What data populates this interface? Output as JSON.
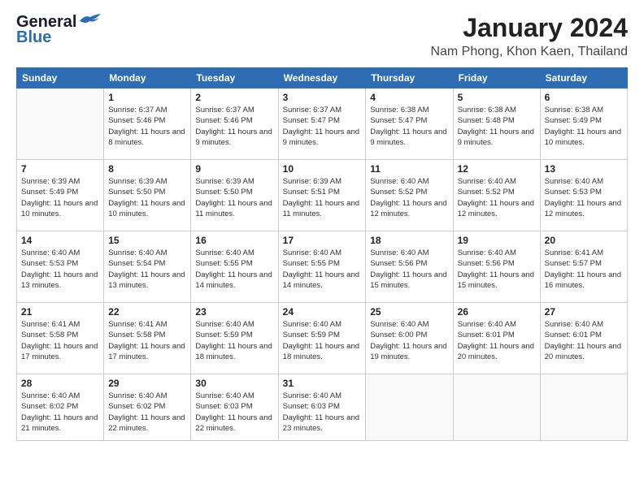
{
  "logo": {
    "general": "General",
    "blue": "Blue"
  },
  "header": {
    "month_year": "January 2024",
    "location": "Nam Phong, Khon Kaen, Thailand"
  },
  "weekdays": [
    "Sunday",
    "Monday",
    "Tuesday",
    "Wednesday",
    "Thursday",
    "Friday",
    "Saturday"
  ],
  "weeks": [
    [
      {
        "day": "",
        "sunrise": "",
        "sunset": "",
        "daylight": ""
      },
      {
        "day": "1",
        "sunrise": "Sunrise: 6:37 AM",
        "sunset": "Sunset: 5:46 PM",
        "daylight": "Daylight: 11 hours and 8 minutes."
      },
      {
        "day": "2",
        "sunrise": "Sunrise: 6:37 AM",
        "sunset": "Sunset: 5:46 PM",
        "daylight": "Daylight: 11 hours and 9 minutes."
      },
      {
        "day": "3",
        "sunrise": "Sunrise: 6:37 AM",
        "sunset": "Sunset: 5:47 PM",
        "daylight": "Daylight: 11 hours and 9 minutes."
      },
      {
        "day": "4",
        "sunrise": "Sunrise: 6:38 AM",
        "sunset": "Sunset: 5:47 PM",
        "daylight": "Daylight: 11 hours and 9 minutes."
      },
      {
        "day": "5",
        "sunrise": "Sunrise: 6:38 AM",
        "sunset": "Sunset: 5:48 PM",
        "daylight": "Daylight: 11 hours and 9 minutes."
      },
      {
        "day": "6",
        "sunrise": "Sunrise: 6:38 AM",
        "sunset": "Sunset: 5:49 PM",
        "daylight": "Daylight: 11 hours and 10 minutes."
      }
    ],
    [
      {
        "day": "7",
        "sunrise": "Sunrise: 6:39 AM",
        "sunset": "Sunset: 5:49 PM",
        "daylight": "Daylight: 11 hours and 10 minutes."
      },
      {
        "day": "8",
        "sunrise": "Sunrise: 6:39 AM",
        "sunset": "Sunset: 5:50 PM",
        "daylight": "Daylight: 11 hours and 10 minutes."
      },
      {
        "day": "9",
        "sunrise": "Sunrise: 6:39 AM",
        "sunset": "Sunset: 5:50 PM",
        "daylight": "Daylight: 11 hours and 11 minutes."
      },
      {
        "day": "10",
        "sunrise": "Sunrise: 6:39 AM",
        "sunset": "Sunset: 5:51 PM",
        "daylight": "Daylight: 11 hours and 11 minutes."
      },
      {
        "day": "11",
        "sunrise": "Sunrise: 6:40 AM",
        "sunset": "Sunset: 5:52 PM",
        "daylight": "Daylight: 11 hours and 12 minutes."
      },
      {
        "day": "12",
        "sunrise": "Sunrise: 6:40 AM",
        "sunset": "Sunset: 5:52 PM",
        "daylight": "Daylight: 11 hours and 12 minutes."
      },
      {
        "day": "13",
        "sunrise": "Sunrise: 6:40 AM",
        "sunset": "Sunset: 5:53 PM",
        "daylight": "Daylight: 11 hours and 12 minutes."
      }
    ],
    [
      {
        "day": "14",
        "sunrise": "Sunrise: 6:40 AM",
        "sunset": "Sunset: 5:53 PM",
        "daylight": "Daylight: 11 hours and 13 minutes."
      },
      {
        "day": "15",
        "sunrise": "Sunrise: 6:40 AM",
        "sunset": "Sunset: 5:54 PM",
        "daylight": "Daylight: 11 hours and 13 minutes."
      },
      {
        "day": "16",
        "sunrise": "Sunrise: 6:40 AM",
        "sunset": "Sunset: 5:55 PM",
        "daylight": "Daylight: 11 hours and 14 minutes."
      },
      {
        "day": "17",
        "sunrise": "Sunrise: 6:40 AM",
        "sunset": "Sunset: 5:55 PM",
        "daylight": "Daylight: 11 hours and 14 minutes."
      },
      {
        "day": "18",
        "sunrise": "Sunrise: 6:40 AM",
        "sunset": "Sunset: 5:56 PM",
        "daylight": "Daylight: 11 hours and 15 minutes."
      },
      {
        "day": "19",
        "sunrise": "Sunrise: 6:40 AM",
        "sunset": "Sunset: 5:56 PM",
        "daylight": "Daylight: 11 hours and 15 minutes."
      },
      {
        "day": "20",
        "sunrise": "Sunrise: 6:41 AM",
        "sunset": "Sunset: 5:57 PM",
        "daylight": "Daylight: 11 hours and 16 minutes."
      }
    ],
    [
      {
        "day": "21",
        "sunrise": "Sunrise: 6:41 AM",
        "sunset": "Sunset: 5:58 PM",
        "daylight": "Daylight: 11 hours and 17 minutes."
      },
      {
        "day": "22",
        "sunrise": "Sunrise: 6:41 AM",
        "sunset": "Sunset: 5:58 PM",
        "daylight": "Daylight: 11 hours and 17 minutes."
      },
      {
        "day": "23",
        "sunrise": "Sunrise: 6:40 AM",
        "sunset": "Sunset: 5:59 PM",
        "daylight": "Daylight: 11 hours and 18 minutes."
      },
      {
        "day": "24",
        "sunrise": "Sunrise: 6:40 AM",
        "sunset": "Sunset: 5:59 PM",
        "daylight": "Daylight: 11 hours and 18 minutes."
      },
      {
        "day": "25",
        "sunrise": "Sunrise: 6:40 AM",
        "sunset": "Sunset: 6:00 PM",
        "daylight": "Daylight: 11 hours and 19 minutes."
      },
      {
        "day": "26",
        "sunrise": "Sunrise: 6:40 AM",
        "sunset": "Sunset: 6:01 PM",
        "daylight": "Daylight: 11 hours and 20 minutes."
      },
      {
        "day": "27",
        "sunrise": "Sunrise: 6:40 AM",
        "sunset": "Sunset: 6:01 PM",
        "daylight": "Daylight: 11 hours and 20 minutes."
      }
    ],
    [
      {
        "day": "28",
        "sunrise": "Sunrise: 6:40 AM",
        "sunset": "Sunset: 6:02 PM",
        "daylight": "Daylight: 11 hours and 21 minutes."
      },
      {
        "day": "29",
        "sunrise": "Sunrise: 6:40 AM",
        "sunset": "Sunset: 6:02 PM",
        "daylight": "Daylight: 11 hours and 22 minutes."
      },
      {
        "day": "30",
        "sunrise": "Sunrise: 6:40 AM",
        "sunset": "Sunset: 6:03 PM",
        "daylight": "Daylight: 11 hours and 22 minutes."
      },
      {
        "day": "31",
        "sunrise": "Sunrise: 6:40 AM",
        "sunset": "Sunset: 6:03 PM",
        "daylight": "Daylight: 11 hours and 23 minutes."
      },
      {
        "day": "",
        "sunrise": "",
        "sunset": "",
        "daylight": ""
      },
      {
        "day": "",
        "sunrise": "",
        "sunset": "",
        "daylight": ""
      },
      {
        "day": "",
        "sunrise": "",
        "sunset": "",
        "daylight": ""
      }
    ]
  ]
}
